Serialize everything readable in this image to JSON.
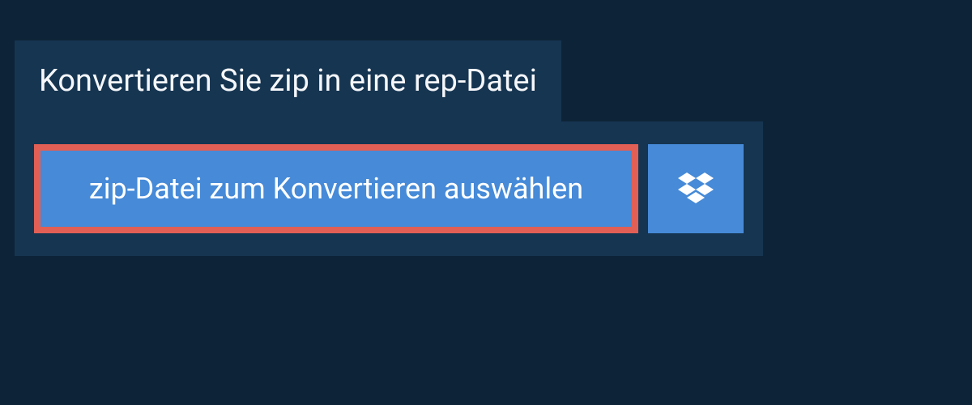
{
  "header": {
    "title": "Konvertieren Sie zip in eine rep-Datei"
  },
  "buttons": {
    "select_label": "zip-Datei zum Konvertieren auswählen"
  },
  "colors": {
    "background": "#0d2438",
    "panel": "#163551",
    "button_bg": "#468ad8",
    "highlight_border": "#e15f55",
    "text": "#ffffff"
  }
}
